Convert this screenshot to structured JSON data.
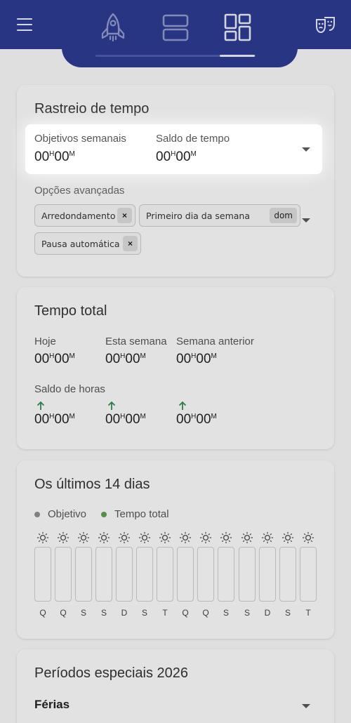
{
  "header": {
    "nav_icons": [
      "rocket-icon",
      "list-view-icon",
      "dashboard-icon"
    ],
    "active_nav": "dashboard-icon",
    "colors": {
      "bar": "#2c3a8e"
    }
  },
  "tracking": {
    "title": "Rastreio de tempo",
    "weekly_goals_label": "Objetivos semanais",
    "weekly_goals_value": "00",
    "time_balance_label": "Saldo de tempo",
    "time_balance_value": "00",
    "advanced_label": "Opções avançadas",
    "chips": {
      "rounding": "Arredondamento",
      "first_day": "Primeiro dia da semana",
      "first_day_value": "dom",
      "auto_pause": "Pausa automática",
      "remove": "×"
    }
  },
  "total": {
    "title": "Tempo total",
    "today_label": "Hoje",
    "this_week_label": "Esta semana",
    "last_week_label": "Semana anterior",
    "balance_label": "Saldo de horas",
    "hours_unit": "H",
    "minutes_unit": "M",
    "zero": "00"
  },
  "last14": {
    "title": "Os últimos 14 dias",
    "legend_goal": "Objetivo",
    "legend_total": "Tempo total",
    "colors": {
      "goal": "#8a8a8a",
      "total": "#5d9b4a"
    },
    "days": [
      "Q",
      "Q",
      "S",
      "S",
      "D",
      "S",
      "T",
      "Q",
      "Q",
      "S",
      "S",
      "D",
      "S",
      "T"
    ]
  },
  "special": {
    "title": "Períodos especiais 2026",
    "vacation_label": "Férias"
  }
}
